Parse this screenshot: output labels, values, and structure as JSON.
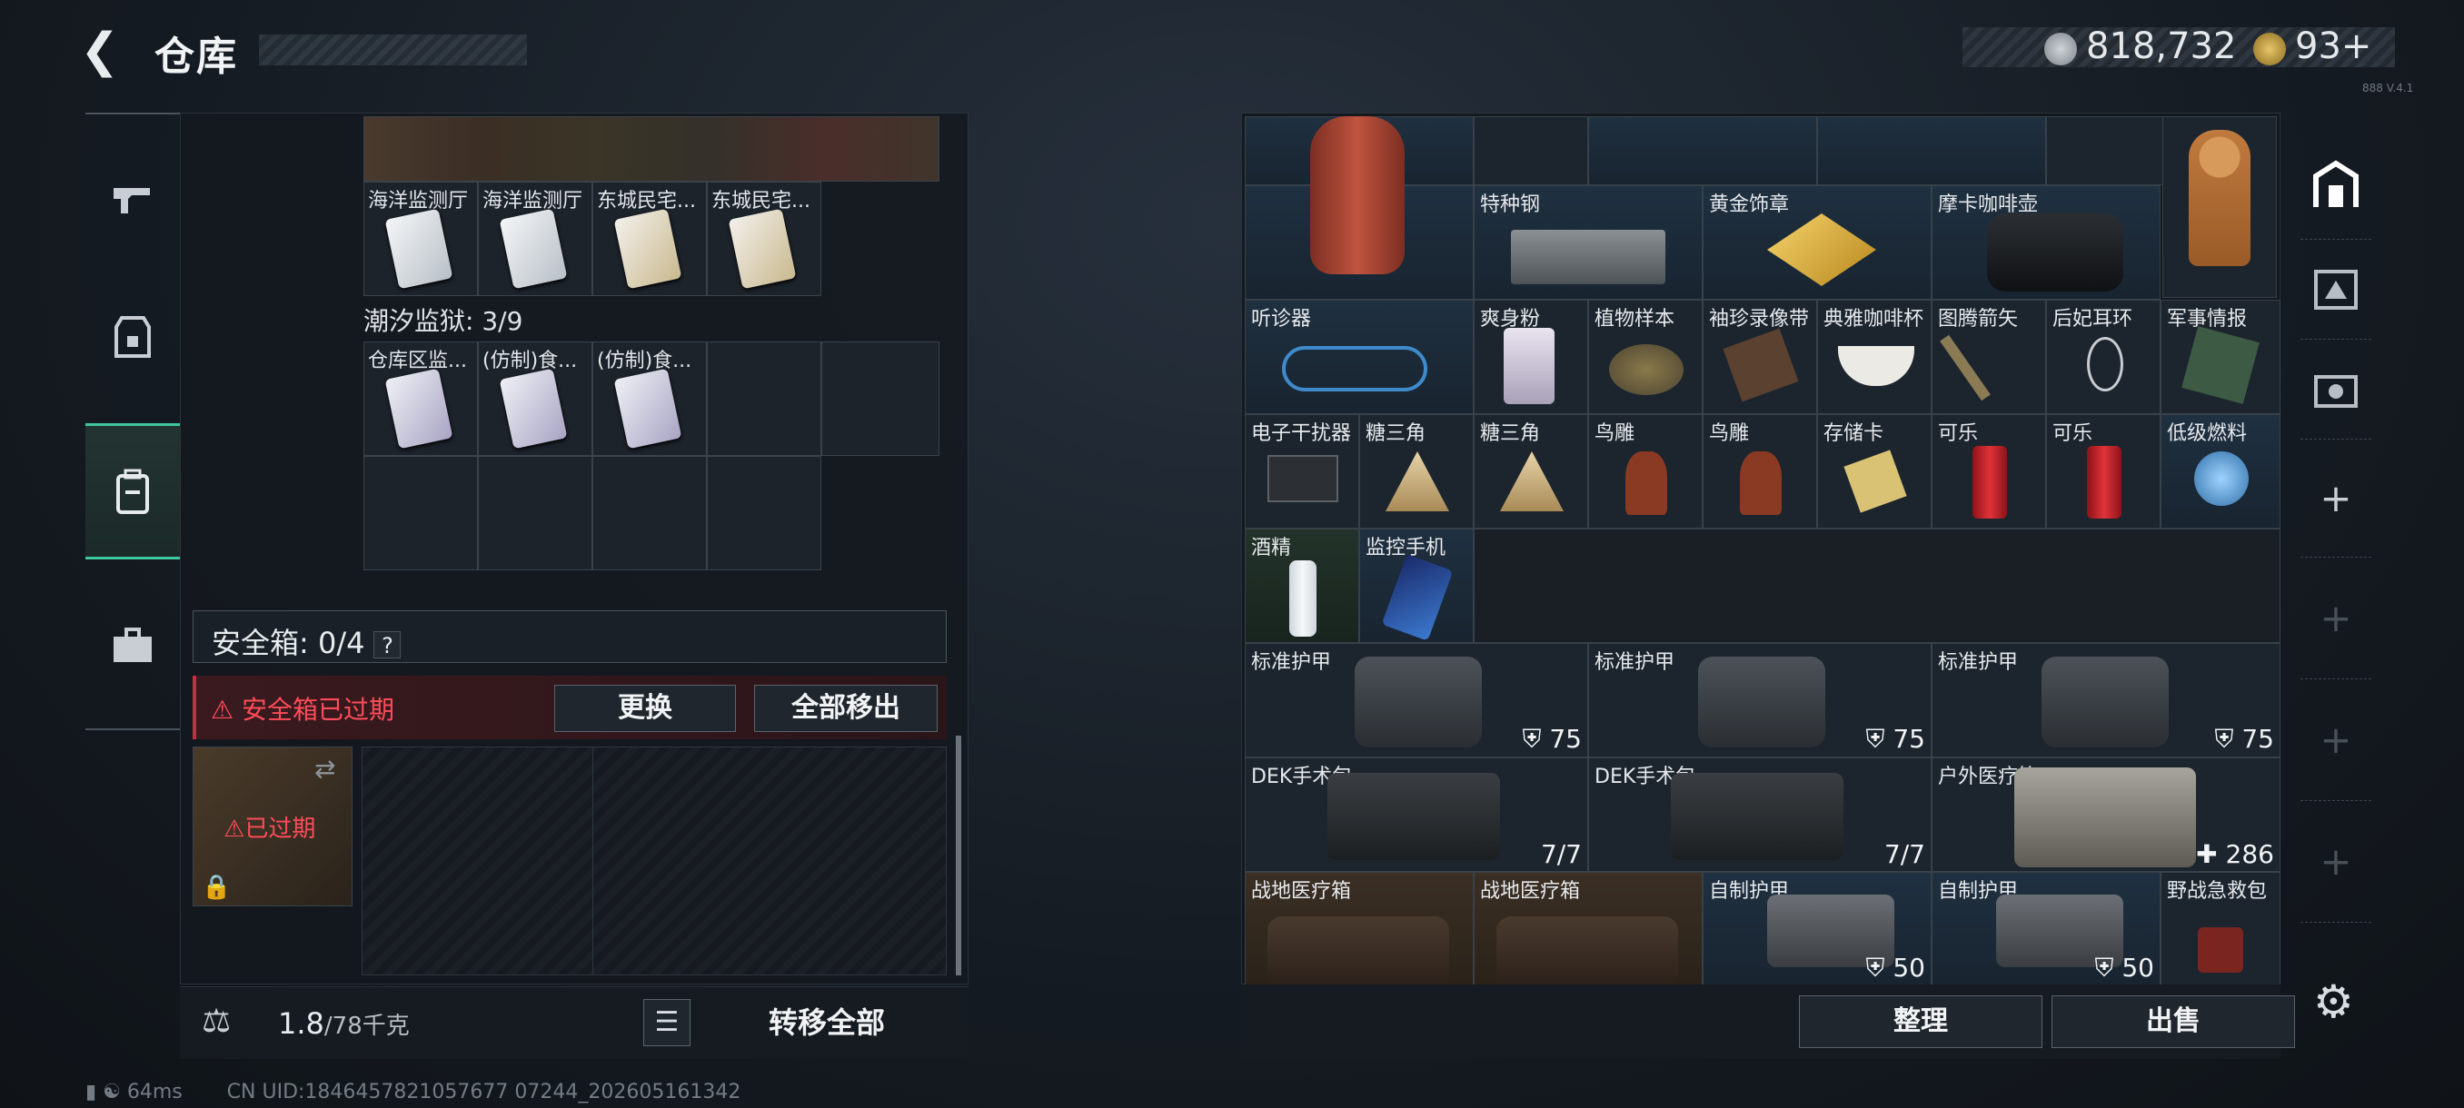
{
  "header": {
    "back_icon": "back-arrow-icon",
    "title": "仓库"
  },
  "currency": {
    "silver": "818,732",
    "gold": "93",
    "plus": "+",
    "version_text": "888 V.4.1"
  },
  "left_nav": [
    {
      "name": "weapon",
      "icon": "gun-icon"
    },
    {
      "name": "armor",
      "icon": "vest-icon"
    },
    {
      "name": "backpack",
      "icon": "backpack-icon",
      "active": true
    },
    {
      "name": "case",
      "icon": "briefcase-icon"
    }
  ],
  "storage": {
    "row1_labels": [
      "海洋监测厅",
      "海洋监测厅",
      "东城民宅...",
      "东城民宅..."
    ],
    "section_label": "潮汐监狱: 3/9",
    "row3_labels": [
      "仓库区监...",
      "(仿制)食...",
      "(仿制)食..."
    ]
  },
  "safebox": {
    "label": "安全箱: 0/4",
    "help": "?",
    "warning": "安全箱已过期",
    "replace_button": "更换",
    "move_all_button": "全部移出",
    "expired_label": "已过期"
  },
  "weight": {
    "value": "1.8",
    "capacity": "/78千克",
    "transfer_button": "转移全部"
  },
  "status": {
    "ping": "64ms",
    "uid": "CN UID:1846457821057677 07244_202605161342"
  },
  "right_grid": {
    "row1": [
      "特种钢",
      "黄金饰章",
      "摩卡咖啡壶"
    ],
    "row2": [
      "听诊器",
      "爽身粉",
      "植物样本",
      "袖珍录像带",
      "典雅咖啡杯",
      "图腾箭矢",
      "后妃耳环",
      "军事情报"
    ],
    "row3": [
      "电子干扰器",
      "糖三角",
      "糖三角",
      "鸟雕",
      "鸟雕",
      "存储卡",
      "可乐",
      "可乐",
      "低级燃料"
    ],
    "row4": [
      "酒精",
      "监控手机"
    ],
    "armor": [
      {
        "label": "标准护甲",
        "value": "75"
      },
      {
        "label": "标准护甲",
        "value": "75"
      },
      {
        "label": "标准护甲",
        "value": "75"
      }
    ],
    "medkits": [
      {
        "label": "DEK手术包",
        "value": "7/7"
      },
      {
        "label": "DEK手术包",
        "value": "7/7"
      },
      {
        "label": "户外医疗箱",
        "value": "286"
      }
    ],
    "row7": [
      {
        "label": "战地医疗箱"
      },
      {
        "label": "战地医疗箱"
      },
      {
        "label": "自制护甲",
        "value": "50"
      },
      {
        "label": "自制护甲",
        "value": "50"
      },
      {
        "label": "野战急救包"
      }
    ]
  },
  "right_buttons": {
    "sort": "整理",
    "sell": "出售"
  },
  "right_nav": [
    "vault-icon",
    "equipment-icon",
    "storage-iv-icon",
    "add-icon",
    "add-icon",
    "add-icon",
    "add-icon",
    "add-icon"
  ]
}
